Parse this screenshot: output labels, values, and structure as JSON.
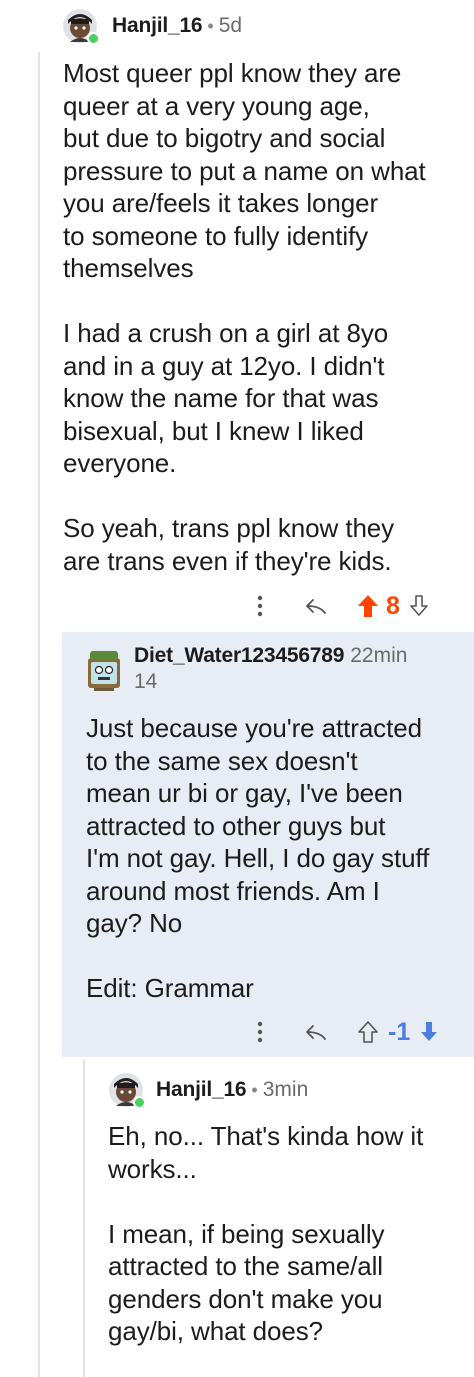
{
  "colors": {
    "upvote_active": "#ff4500",
    "downvote_active": "#4a7fe0",
    "highlight_bg": "#e8ecf5",
    "online": "#46d160"
  },
  "comments": [
    {
      "username": "Hanjil_16",
      "separator": "•",
      "time": "5d",
      "avatar_icon": "avatar-icon",
      "body": "Most queer ppl know they are\nqueer at a very young age,\nbut due to bigotry and social\npressure to put a name on what\nyou are/feels it takes longer\nto someone to fully identify\nthemselves\n\nI had a crush on a girl at 8yo\nand in a guy at 12yo. I didn't\nknow the name for that was\nbisexual, but I knew I liked\neveryone.\n\nSo yeah, trans ppl know they\nare trans even if they're kids.",
      "score": "8",
      "vote_state": "upvoted"
    },
    {
      "username": "Diet_Water123456789",
      "time": "22min",
      "karma": "14",
      "avatar_icon": "avatar-icon",
      "body": "Just because you're attracted\nto the same sex doesn't\nmean ur bi or gay, I've been\nattracted to other guys but\nI'm not gay. Hell, I do gay stuff\naround most friends. Am I\ngay? No\n\nEdit: Grammar",
      "score": "-1",
      "vote_state": "downvoted"
    },
    {
      "username": "Hanjil_16",
      "separator": "•",
      "time": "3min",
      "avatar_icon": "avatar-icon",
      "body": "Eh, no... That's kinda how it\nworks...\n\nI mean, if being sexually\nattracted to the same/all\ngenders don't make you\ngay/bi, what does?"
    }
  ]
}
